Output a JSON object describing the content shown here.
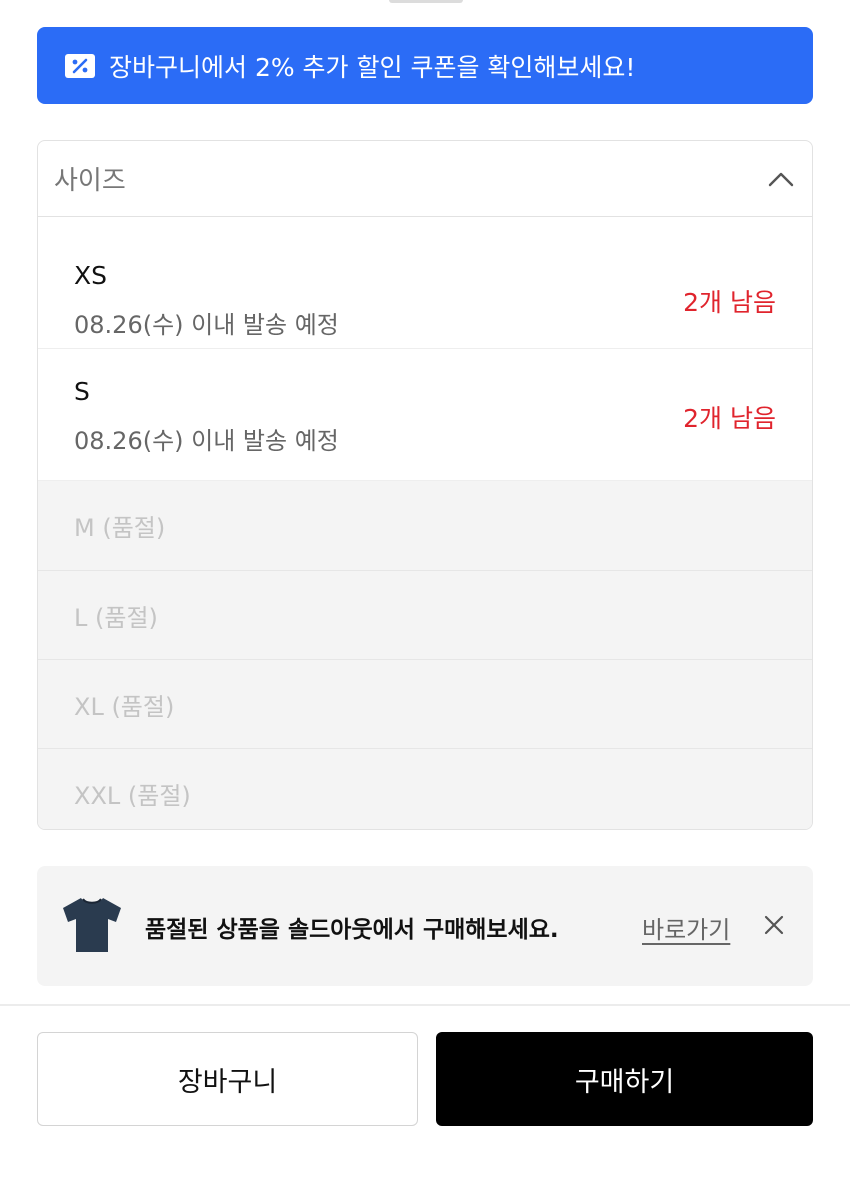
{
  "coupon_banner": {
    "text": "장바구니에서 2% 추가 할인 쿠폰을 확인해보세요!",
    "icon": "coupon-icon",
    "color": "#2b6cf6"
  },
  "size_select": {
    "label": "사이즈",
    "icon": "chevron-up-icon",
    "options": [
      {
        "name": "XS",
        "shipping": "08.26(수) 이내 발송 예정",
        "stock": "2개 남음"
      },
      {
        "name": "S",
        "shipping": "08.26(수) 이내 발송 예정",
        "stock": "2개 남음"
      }
    ],
    "soldout_options": [
      "M (품절)",
      "L (품절)",
      "XL (품절)",
      "XXL (품절)"
    ],
    "stock_color": "#e0242d"
  },
  "soldout_banner": {
    "text": "품절된 상품을 솔드아웃에서 구매해보세요.",
    "link": "바로가기",
    "icon": "tshirt-icon",
    "close_icon": "close-icon"
  },
  "actions": {
    "cart": "장바구니",
    "buy": "구매하기"
  }
}
